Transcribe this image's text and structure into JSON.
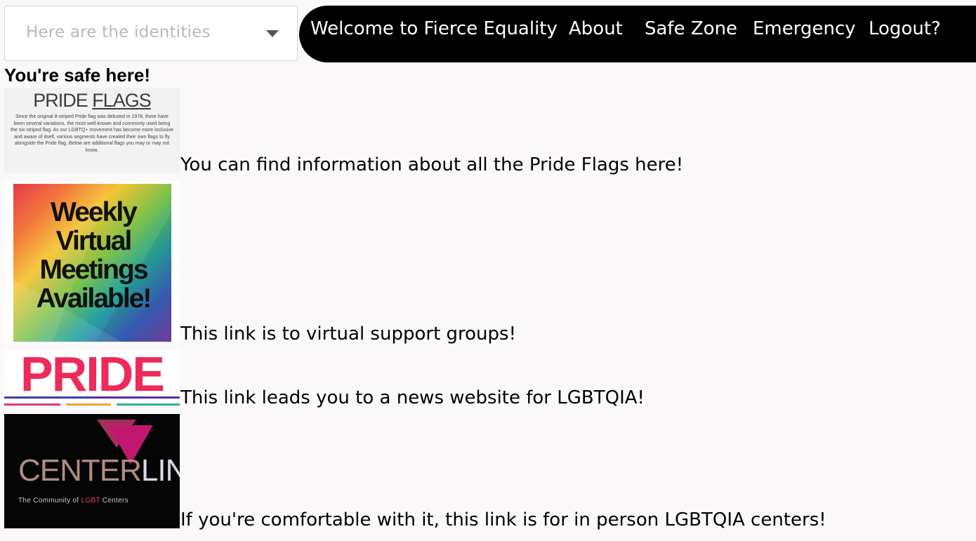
{
  "identity_select": {
    "placeholder": "Here are the identities"
  },
  "nav": {
    "items": [
      {
        "label": "Welcome to Fierce Equality"
      },
      {
        "label": "About"
      },
      {
        "label": "Safe Zone"
      },
      {
        "label": "Emergency"
      },
      {
        "label": "Logout?"
      }
    ]
  },
  "main": {
    "heading": "You're safe here!",
    "resources": [
      {
        "text": "You can find information about all the Pride Flags here!",
        "thumb": {
          "title_plain": "PRIDE",
          "title_underlined": "FLAGS",
          "body": "Since the original 8-striped Pride flag was debuted in 1978, there have been several variations, the most well-known and commonly used being the six-striped flag. As our LGBTQ+ movement has become more inclusive and aware of itself, various segments have created their own flags to fly alongside the Pride flag. Below are additional flags you may or may not know."
        }
      },
      {
        "text": "This link is to virtual support groups!",
        "thumb": {
          "line1": "Weekly",
          "line2": "Virtual",
          "line3": "Meetings",
          "line4": "Available!"
        }
      },
      {
        "text": "This link leads you to a news website for LGBTQIA!",
        "thumb": {
          "word": "PRIDE"
        }
      },
      {
        "text": "If you're comfortable with it, this link is for in person LGBTQIA centers!",
        "thumb": {
          "word_part1": "CENTER",
          "word_part2": "LINK",
          "sub_part1": "The Community of ",
          "sub_part2": "LGBT",
          "sub_part3": " Centers"
        }
      }
    ]
  },
  "colors": {
    "nav_bg": "#000000",
    "page_bg": "#fbf8f9",
    "pride_pink": "#ee2a5a",
    "centerlink_magenta": "#c0186f"
  }
}
